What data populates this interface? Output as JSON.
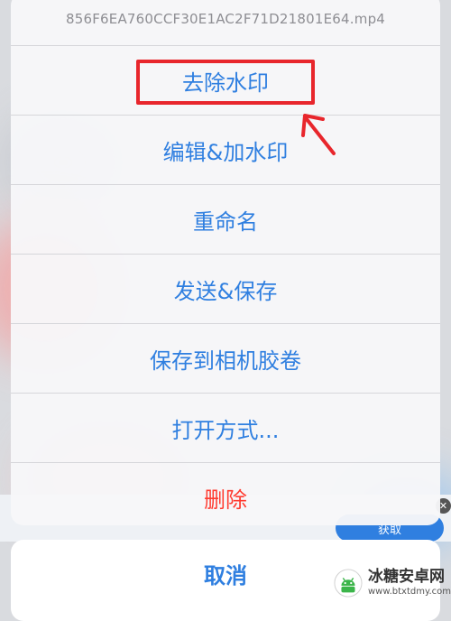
{
  "sheet": {
    "title": "856F6EA760CCF30E1AC2F71D21801E64.mp4",
    "actions": [
      {
        "label": "去除水印",
        "style": "default"
      },
      {
        "label": "编辑&加水印",
        "style": "default"
      },
      {
        "label": "重命名",
        "style": "default"
      },
      {
        "label": "发送&保存",
        "style": "default"
      },
      {
        "label": "保存到相机胶卷",
        "style": "default"
      },
      {
        "label": "打开方式...",
        "style": "default"
      },
      {
        "label": "删除",
        "style": "destructive"
      }
    ],
    "cancel_label": "取消"
  },
  "ad": {
    "button_label": "获取",
    "close_glyph": "✕"
  },
  "annotation": {
    "highlight_color": "#e8262c",
    "arrow_color": "#e8262c"
  },
  "watermark": {
    "name": "冰糖安卓网",
    "url": "www.btxtdmy.com"
  },
  "colors": {
    "action_blue": "#2f7fe0",
    "destructive_red": "#ff3b30"
  }
}
